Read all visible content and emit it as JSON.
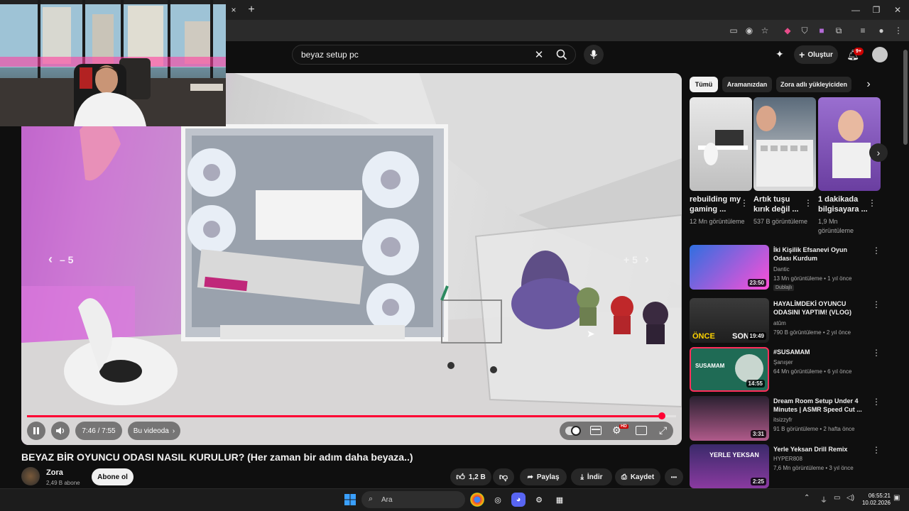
{
  "browser": {
    "tab_close": "×",
    "new_tab": "+",
    "window_controls": [
      "—",
      "❐",
      "✕"
    ],
    "extension_icons": [
      "screen-share-icon",
      "eye-off-icon",
      "star-icon",
      "extension-a-icon",
      "shield-icon",
      "extension-b-icon",
      "puzzle-icon",
      "media-icon",
      "profile-icon",
      "menu-icon"
    ]
  },
  "youtube": {
    "search_query": "beyaz setup pc",
    "create_label": "Oluştur",
    "notifications_badge": "9+",
    "colors": {
      "background": "#0f0f0f",
      "accent": "#ff0033",
      "chip": "#272727"
    }
  },
  "player": {
    "rewind_label": "– 5",
    "forward_label": "+ 5",
    "current_time": "7:46",
    "duration": "7:55",
    "time_display": "7:46 / 7:55",
    "progress_fraction": 0.978,
    "chapters_label": "Bu videoda",
    "settings_badge": "HD"
  },
  "video": {
    "title": "BEYAZ BİR OYUNCU ODASI NASIL KURULUR? (Her zaman bir adım daha beyaza..)",
    "channel": "Zora",
    "subscribers": "2,49 B abone",
    "subscribe_label": "Abone ol",
    "likes": "1,2 B",
    "share_label": "Paylaş",
    "download_label": "İndir",
    "save_label": "Kaydet",
    "more_label": "•••"
  },
  "sidebar": {
    "chips": [
      "Tümü",
      "Aramanızdan",
      "Zora adlı yükleyiciden"
    ],
    "shorts": [
      {
        "title": "rebuilding my gaming ...",
        "views": "12 Mn görüntüleme"
      },
      {
        "title": "Artık tuşu kırık değil ...",
        "views": "537 B görüntüleme"
      },
      {
        "title": "1 dakikada bilgisayara ...",
        "views": "1,9 Mn görüntüleme"
      }
    ],
    "recommendations": [
      {
        "title": "İki Kişilik Efsanevi Oyun Odası Kurdum",
        "channel": "Dantic",
        "meta": "13 Mn görüntüleme • 1 yıl önce",
        "duration": "23:50",
        "badge": "Dublajlı"
      },
      {
        "title": "HAYALİMDEKİ OYUNCU ODASINI YAPTIM! (VLOG)",
        "channel": "atûm",
        "meta": "790 B görüntüleme • 2 yıl önce",
        "duration": "19:49",
        "thumb_text_left": "ÖNCE",
        "thumb_text_right": "SON"
      },
      {
        "title": "#SUSAMAM",
        "channel": "Şanışer",
        "meta": "64 Mn görüntüleme • 6 yıl önce",
        "duration": "14:55",
        "thumb_text": "SUSAMAM"
      },
      {
        "title": "Dream Room Setup Under 4 Minutes | ASMR Speed Cut ...",
        "channel": "itsizzyfr",
        "meta": "91 B görüntüleme • 2 hafta önce",
        "duration": "3:31"
      },
      {
        "title": "Yerle Yeksan Drill Remix",
        "channel": "HYPER808",
        "meta": "7,6 Mn görüntüleme • 3 yıl önce",
        "duration": "2:25",
        "thumb_text": "YERLE YEKSAN"
      }
    ]
  },
  "taskbar": {
    "search_placeholder": "Ara",
    "time": "06:55:21",
    "date": "10.02.2026"
  }
}
